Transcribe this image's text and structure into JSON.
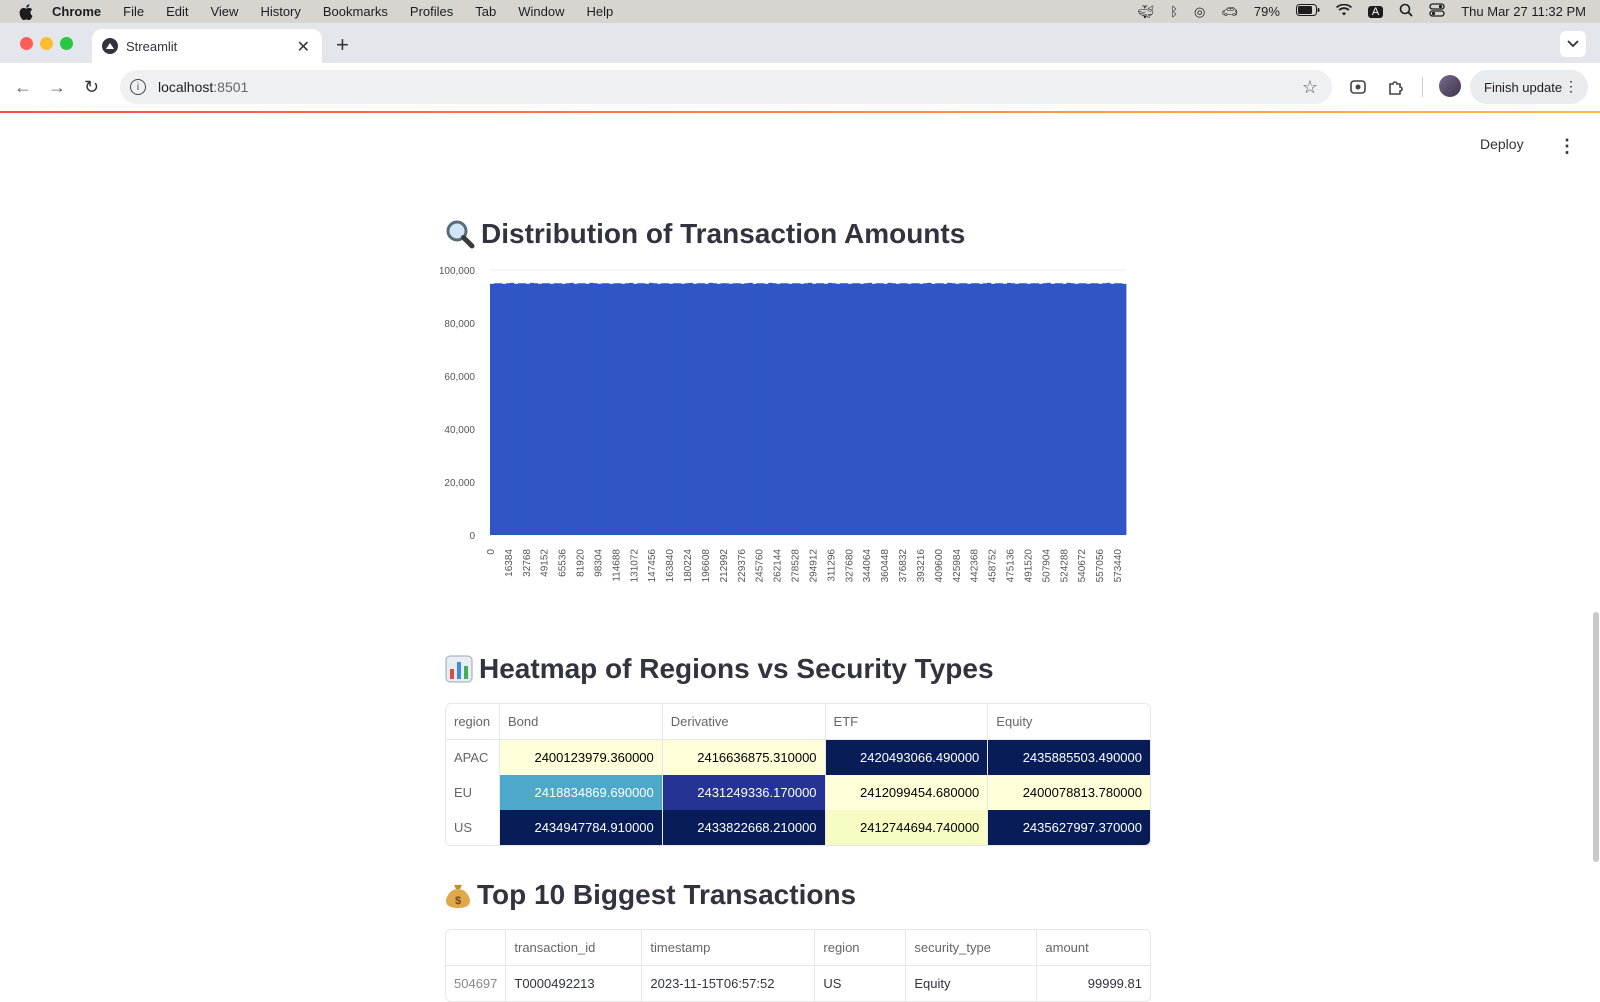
{
  "menubar": {
    "items": [
      "Chrome",
      "File",
      "Edit",
      "View",
      "History",
      "Bookmarks",
      "Profiles",
      "Tab",
      "Window",
      "Help"
    ],
    "battery": "79%",
    "input_indicator": "A",
    "datetime": "Thu Mar 27  11:32 PM"
  },
  "browser": {
    "tab_title": "Streamlit",
    "url_host": "localhost",
    "url_port": ":8501",
    "finish_update_label": "Finish update"
  },
  "app": {
    "deploy_label": "Deploy",
    "sections": {
      "distribution_title": "Distribution of Transaction Amounts",
      "heatmap_title": "Heatmap of Regions vs Security Types",
      "top10_title": "Top 10 Biggest Transactions"
    }
  },
  "chart_data": {
    "type": "bar",
    "title": "",
    "xlabel": "",
    "ylabel": "",
    "ylim": [
      0,
      100000
    ],
    "yticks": [
      "0",
      "20,000",
      "40,000",
      "60,000",
      "80,000",
      "100,000"
    ],
    "xtick_labels": [
      "0",
      "16384",
      "32768",
      "49152",
      "65536",
      "81920",
      "98304",
      "114688",
      "131072",
      "147456",
      "163840",
      "180224",
      "196608",
      "212992",
      "229376",
      "245760",
      "262144",
      "278528",
      "294912",
      "311296",
      "327680",
      "344064",
      "360448",
      "376832",
      "393216",
      "409600",
      "425984",
      "442368",
      "458752",
      "475136",
      "491520",
      "507904",
      "524288",
      "540672",
      "557056",
      "573440"
    ],
    "x_range": [
      0,
      580000
    ],
    "approx_bar_height": 95000,
    "bar_color": "#2f56c4",
    "grid": true
  },
  "heatmap": {
    "columns": [
      "region",
      "Bond",
      "Derivative",
      "ETF",
      "Equity"
    ],
    "rows": [
      {
        "region": "APAC",
        "cells": [
          {
            "v": "2400123979.360000",
            "bg": "#ffffd9",
            "fg": "#000000"
          },
          {
            "v": "2416636875.310000",
            "bg": "#ffffd9",
            "fg": "#000000"
          },
          {
            "v": "2420493066.490000",
            "bg": "#081d58",
            "fg": "#ffffff"
          },
          {
            "v": "2435885503.490000",
            "bg": "#081d58",
            "fg": "#ffffff"
          }
        ]
      },
      {
        "region": "EU",
        "cells": [
          {
            "v": "2418834869.690000",
            "bg": "#4ea8c9",
            "fg": "#ffffff"
          },
          {
            "v": "2431249336.170000",
            "bg": "#253494",
            "fg": "#ffffff"
          },
          {
            "v": "2412099454.680000",
            "bg": "#ffffd9",
            "fg": "#000000"
          },
          {
            "v": "2400078813.780000",
            "bg": "#ffffd9",
            "fg": "#000000"
          }
        ]
      },
      {
        "region": "US",
        "cells": [
          {
            "v": "2434947784.910000",
            "bg": "#081d58",
            "fg": "#ffffff"
          },
          {
            "v": "2433822668.210000",
            "bg": "#081d58",
            "fg": "#ffffff"
          },
          {
            "v": "2412744694.740000",
            "bg": "#f7fcc4",
            "fg": "#000000"
          },
          {
            "v": "2435627997.370000",
            "bg": "#081d58",
            "fg": "#ffffff"
          }
        ]
      }
    ]
  },
  "top10": {
    "columns": [
      "",
      "transaction_id",
      "timestamp",
      "region",
      "security_type",
      "amount"
    ],
    "rows": [
      {
        "idx": "504697",
        "transaction_id": "T0000492213",
        "timestamp": "2023-11-15T06:57:52",
        "region": "US",
        "security_type": "Equity",
        "amount": "99999.81"
      }
    ]
  }
}
